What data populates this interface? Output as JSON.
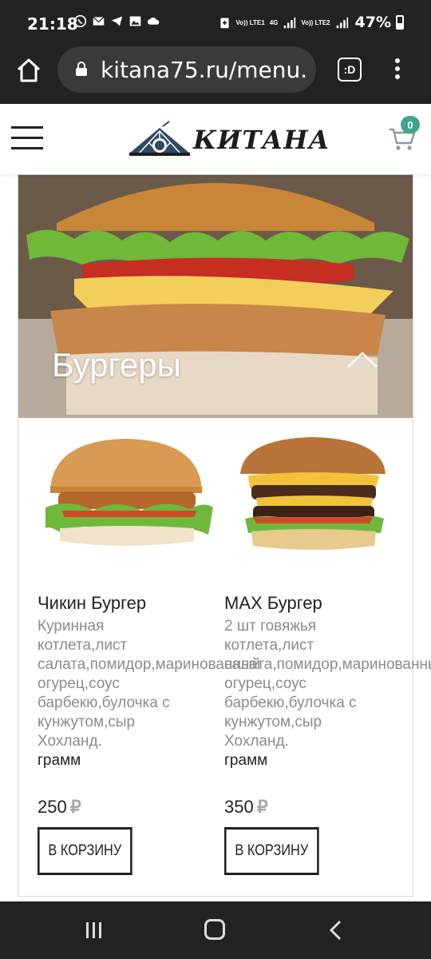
{
  "status_bar": {
    "time": "21:18",
    "net1": "Vo)) LTE1",
    "net2": "4G",
    "net3": "Vo)) LTE2",
    "battery": "47%"
  },
  "browser": {
    "url": "kitana75.ru/menu.",
    "tabs_label": ":D"
  },
  "header": {
    "logo_text": "КИТАНА",
    "cart_count": "0"
  },
  "category": {
    "title": "Бургеры"
  },
  "products": [
    {
      "name": "Чикин Бургер",
      "desc_lines": [
        "Куринная",
        "котлета,лист",
        "салата,помидор,маринованный",
        "огурец,соус",
        "барбекю,булочка с",
        "кунжутом,сыр",
        "Хохланд."
      ],
      "weight": "грамм",
      "price": "250",
      "currency": "₽",
      "button": "В КОРЗИНУ"
    },
    {
      "name": "MAX Бургер",
      "desc_lines": [
        "2 шт говяжья",
        "котлета,лист",
        "салата,помидор,маринованный",
        "огурец,соус",
        "барбекю,булочка с",
        "кунжутом,сыр",
        "Хохланд."
      ],
      "weight": "грамм",
      "price": "350",
      "currency": "₽",
      "button": "В КОРЗИНУ"
    }
  ],
  "colors": {
    "system_bar": "#222222",
    "badge": "#3fa58d",
    "muted_text": "#8c8c8c"
  }
}
